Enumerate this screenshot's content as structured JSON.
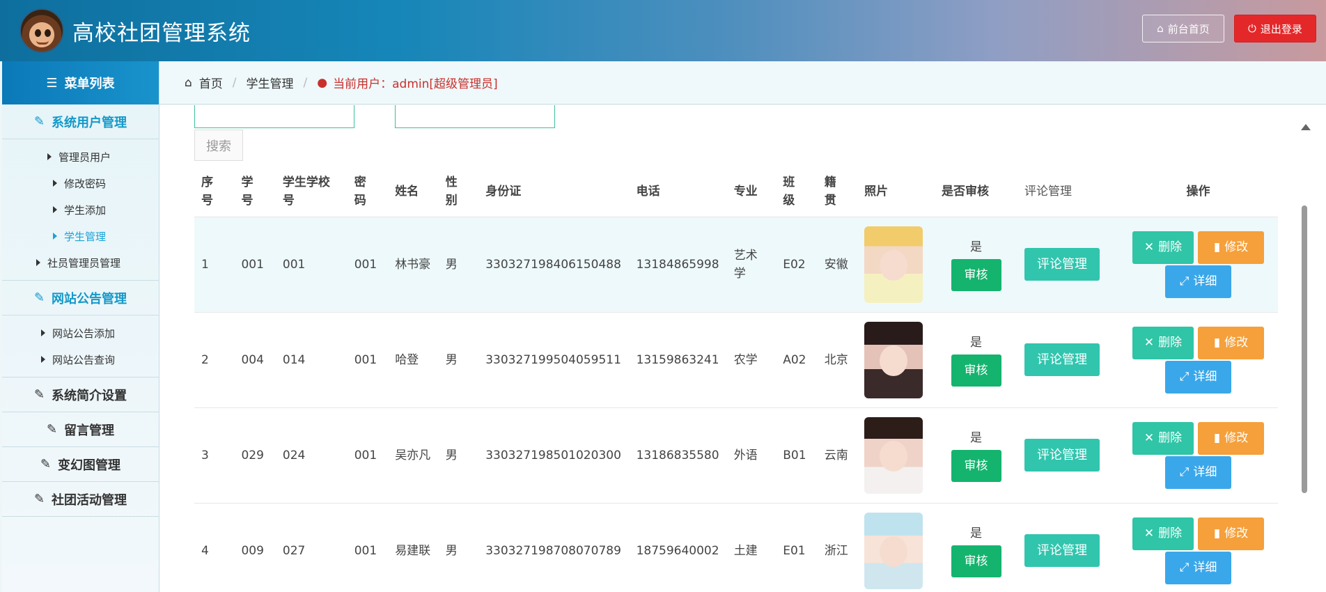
{
  "header": {
    "title": "高校社团管理系统",
    "home_label": "前台首页",
    "logout_label": "退出登录"
  },
  "sidebar": {
    "menu_title": "菜单列表",
    "groups": [
      {
        "label": "系统用户管理",
        "items": [
          "管理员用户",
          "修改密码",
          "学生添加",
          "学生管理",
          "社员管理员管理"
        ]
      },
      {
        "label": "网站公告管理",
        "items": [
          "网站公告添加",
          "网站公告查询"
        ]
      },
      {
        "label": "系统简介设置"
      },
      {
        "label": "留言管理"
      },
      {
        "label": "变幻图管理"
      },
      {
        "label": "社团活动管理"
      }
    ]
  },
  "breadcrumb": {
    "home": "首页",
    "section": "学生管理",
    "current_user": "当前用户：admin[超级管理员]"
  },
  "search": {
    "label": "搜索"
  },
  "table": {
    "headers": [
      "序号",
      "学号",
      "学生学校号",
      "密码",
      "姓名",
      "性别",
      "身份证",
      "电话",
      "专业",
      "班级",
      "籍贯",
      "照片",
      "是否审核",
      "评论管理",
      "操作"
    ],
    "header_lines": [
      [
        "序",
        "号"
      ],
      [
        "学",
        "号"
      ],
      [
        "学生学校",
        "号"
      ],
      [
        "密",
        "码"
      ],
      [
        "姓名"
      ],
      [
        "性",
        "别"
      ],
      [
        "身份证"
      ],
      [
        "电话"
      ],
      [
        "专业"
      ],
      [
        "班",
        "级"
      ],
      [
        "籍",
        "贯"
      ],
      [
        "照片"
      ],
      [
        "是否审核"
      ],
      [
        "评论管理"
      ],
      [
        "操作"
      ]
    ],
    "rows": [
      {
        "no": "1",
        "sid": "001",
        "school_no": "001",
        "pwd": "001",
        "name": "林书豪",
        "gender": "男",
        "idcard": "330327198406150488",
        "phone": "13184865998",
        "major": "艺术学",
        "class": "E02",
        "origin": "安徽",
        "audited": "是"
      },
      {
        "no": "2",
        "sid": "004",
        "school_no": "014",
        "pwd": "001",
        "name": "哈登",
        "gender": "男",
        "idcard": "330327199504059511",
        "phone": "13159863241",
        "major": "农学",
        "class": "A02",
        "origin": "北京",
        "audited": "是"
      },
      {
        "no": "3",
        "sid": "029",
        "school_no": "024",
        "pwd": "001",
        "name": "吴亦凡",
        "gender": "男",
        "idcard": "330327198501020300",
        "phone": "13186835580",
        "major": "外语",
        "class": "B01",
        "origin": "云南",
        "audited": "是"
      },
      {
        "no": "4",
        "sid": "009",
        "school_no": "027",
        "pwd": "001",
        "name": "易建联",
        "gender": "男",
        "idcard": "330327198708070789",
        "phone": "18759640002",
        "major": "土建",
        "class": "E01",
        "origin": "浙江",
        "audited": "是"
      }
    ],
    "buttons": {
      "audit": "审核",
      "comment": "评论管理",
      "delete": "删除",
      "edit": "修改",
      "detail": "详细"
    }
  }
}
